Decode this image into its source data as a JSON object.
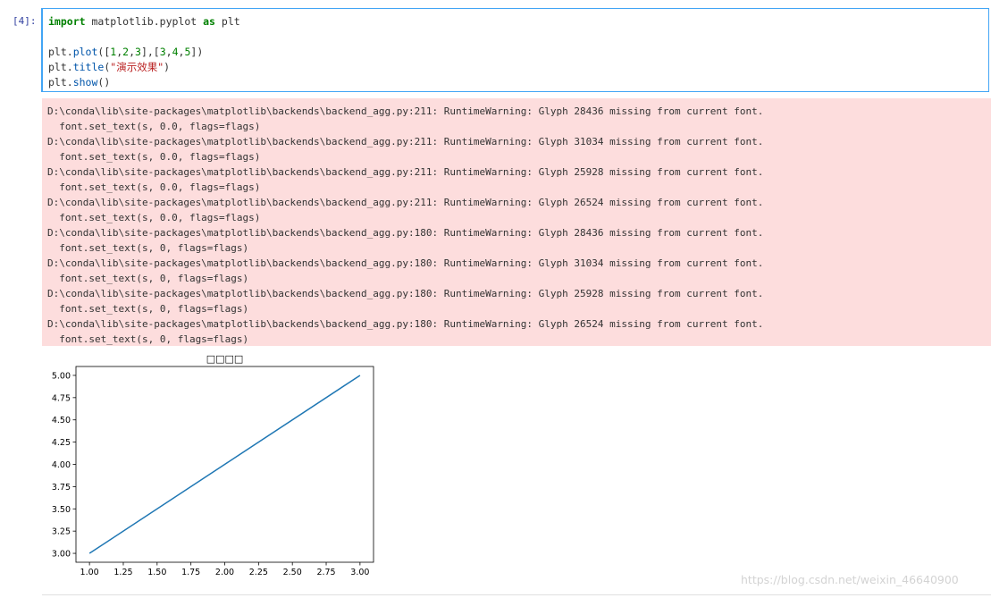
{
  "cell": {
    "prompt": "[4]:",
    "code": {
      "line1": {
        "kw1": "import",
        "mod": "matplotlib.pyplot",
        "kw2": "as",
        "alias": "plt"
      },
      "line2": {
        "obj": "plt.",
        "fn": "plot",
        "args_open": "([",
        "a1": "1",
        "c1": ",",
        "a2": "2",
        "c2": ",",
        "a3": "3",
        "mid": "],[",
        "b1": "3",
        "c3": ",",
        "b2": "4",
        "c4": ",",
        "b3": "5",
        "args_close": "])"
      },
      "line3": {
        "obj": "plt.",
        "fn": "title",
        "open": "(",
        "str": "\"演示效果\"",
        "close": ")"
      },
      "line4": {
        "obj": "plt.",
        "fn": "show",
        "call": "()"
      }
    }
  },
  "stderr": {
    "lines": [
      "D:\\conda\\lib\\site-packages\\matplotlib\\backends\\backend_agg.py:211: RuntimeWarning: Glyph 28436 missing from current font.",
      "  font.set_text(s, 0.0, flags=flags)",
      "D:\\conda\\lib\\site-packages\\matplotlib\\backends\\backend_agg.py:211: RuntimeWarning: Glyph 31034 missing from current font.",
      "  font.set_text(s, 0.0, flags=flags)",
      "D:\\conda\\lib\\site-packages\\matplotlib\\backends\\backend_agg.py:211: RuntimeWarning: Glyph 25928 missing from current font.",
      "  font.set_text(s, 0.0, flags=flags)",
      "D:\\conda\\lib\\site-packages\\matplotlib\\backends\\backend_agg.py:211: RuntimeWarning: Glyph 26524 missing from current font.",
      "  font.set_text(s, 0.0, flags=flags)",
      "D:\\conda\\lib\\site-packages\\matplotlib\\backends\\backend_agg.py:180: RuntimeWarning: Glyph 28436 missing from current font.",
      "  font.set_text(s, 0, flags=flags)",
      "D:\\conda\\lib\\site-packages\\matplotlib\\backends\\backend_agg.py:180: RuntimeWarning: Glyph 31034 missing from current font.",
      "  font.set_text(s, 0, flags=flags)",
      "D:\\conda\\lib\\site-packages\\matplotlib\\backends\\backend_agg.py:180: RuntimeWarning: Glyph 25928 missing from current font.",
      "  font.set_text(s, 0, flags=flags)",
      "D:\\conda\\lib\\site-packages\\matplotlib\\backends\\backend_agg.py:180: RuntimeWarning: Glyph 26524 missing from current font.",
      "  font.set_text(s, 0, flags=flags)"
    ]
  },
  "chart_data": {
    "type": "line",
    "title": "□□□□",
    "xlabel": "",
    "ylabel": "",
    "x": [
      1,
      2,
      3
    ],
    "series": [
      {
        "values": [
          3,
          4,
          5
        ],
        "color": "#1f77b4"
      }
    ],
    "xlim": [
      0.9,
      3.1
    ],
    "ylim": [
      2.9,
      5.1
    ],
    "xticks": [
      "1.00",
      "1.25",
      "1.50",
      "1.75",
      "2.00",
      "2.25",
      "2.50",
      "2.75",
      "3.00"
    ],
    "yticks": [
      "3.00",
      "3.25",
      "3.50",
      "3.75",
      "4.00",
      "4.25",
      "4.50",
      "4.75",
      "5.00"
    ],
    "grid": false
  },
  "watermark": "https://blog.csdn.net/weixin_46640900"
}
